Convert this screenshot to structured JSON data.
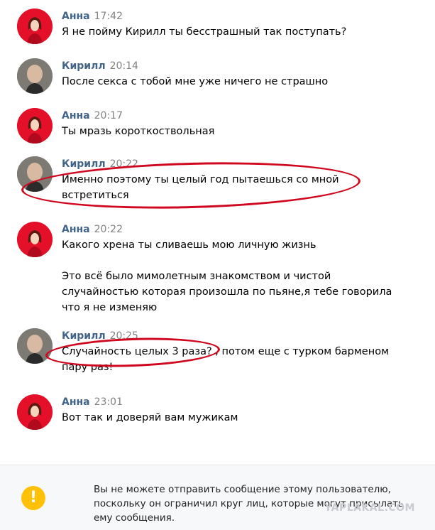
{
  "messages": [
    {
      "author": "Анна",
      "time": "17:42",
      "text": "Я не пойму Кирилл ты бесстрашный так поступать?",
      "avatar": "anna"
    },
    {
      "author": "Кирилл",
      "time": "20:14",
      "text": "После секса с тобой мне уже ничего не страшно",
      "avatar": "kirill"
    },
    {
      "author": "Анна",
      "time": "20:17",
      "text": "Ты мразь короткоствольная",
      "avatar": "anna"
    },
    {
      "author": "Кирилл",
      "time": "20:22",
      "text": "Именно поэтому ты целый год пытаешься со мной\nвстретиться",
      "avatar": "kirill"
    },
    {
      "author": "Анна",
      "time": "20:22",
      "text": "Какого хрена ты сливаешь мою личную жизнь\n\nЭто всё было мимолетным знакомством и чистой\nслучайностью которая произошла по пьяне,я тебе говорила\nчто я не изменяю",
      "avatar": "anna"
    },
    {
      "author": "Кирилл",
      "time": "20:25",
      "text": "Случайность целых 3 раза? , потом еще с турком барменом\nпару раз!",
      "avatar": "kirill"
    },
    {
      "author": "Анна",
      "time": "23:01",
      "text": "Вот так и доверяй вам мужикам",
      "avatar": "anna"
    }
  ],
  "footer": {
    "notice": "Вы не можете отправить сообщение этому пользователю,\nпоскольку он ограничил круг лиц, которые могут присылать\nему сообщения.",
    "warning_icon_glyph": "!"
  },
  "watermark": "YAPLAKAL.COM",
  "colors": {
    "author": "#42648b",
    "time": "#828282",
    "highlight_circle": "#d0081f",
    "warning": "#ffc107"
  }
}
